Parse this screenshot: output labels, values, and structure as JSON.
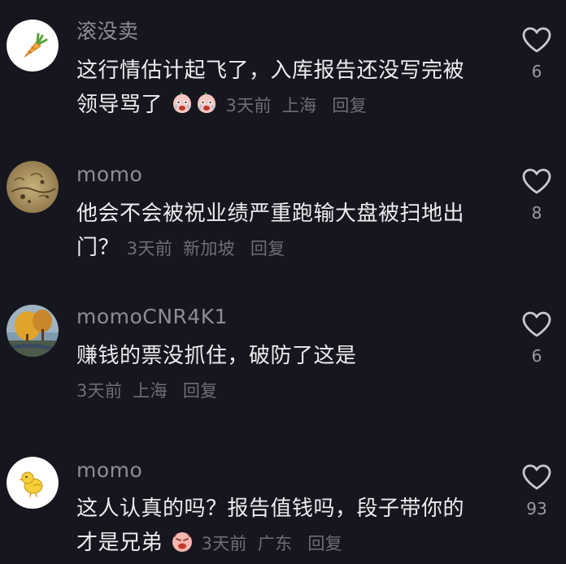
{
  "comments": [
    {
      "username": "滚没卖",
      "avatar": "carrot-avatar",
      "text": "这行情估计起飞了，入库报告还没写完被领导骂了",
      "emoji": "crying-peach-emoji",
      "time": "3天前",
      "location": "上海",
      "reply": "回复",
      "likes": "6"
    },
    {
      "username": "momo",
      "avatar": "painting-avatar",
      "text": "他会不会被祝业绩严重跑输大盘被扫地出门？",
      "time": "3天前",
      "location": "新加坡",
      "reply": "回复",
      "likes": "8"
    },
    {
      "username": "momoCNR4K1",
      "avatar": "autumn-tree-avatar",
      "text": "赚钱的票没抓住，破防了这是",
      "time": "3天前",
      "location": "上海",
      "reply": "回复",
      "likes": "6"
    },
    {
      "username": "momo",
      "avatar": "chick-avatar",
      "text": "这人认真的吗？报告值钱吗，段子带你的才是兄弟",
      "emoji": "sad-face-emoji",
      "time": "3天前",
      "location": "广东",
      "reply": "回复",
      "likes": "93"
    }
  ],
  "colors": {
    "background": "#16161e",
    "text": "#ecedf0",
    "username": "#8d8d96",
    "meta": "#6d6d76",
    "icon": "#c8c8cf"
  }
}
